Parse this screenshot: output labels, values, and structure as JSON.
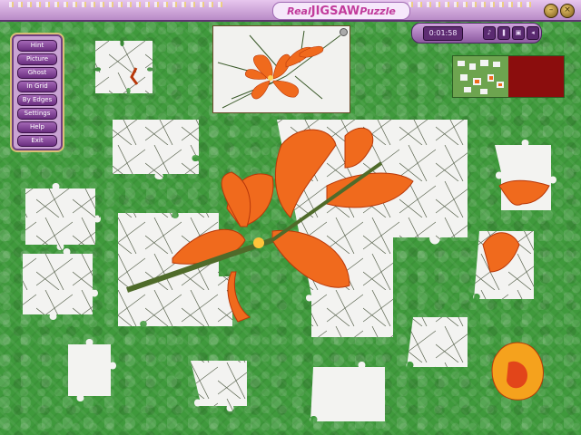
{
  "title": {
    "part1": "Real",
    "part2": "JIGSAW",
    "part3": "Puzzle"
  },
  "menu": {
    "items": [
      {
        "label": "Hint"
      },
      {
        "label": "Picture"
      },
      {
        "label": "Ghost"
      },
      {
        "label": "In Grid"
      },
      {
        "label": "By Edges"
      },
      {
        "label": "Settings"
      },
      {
        "label": "Help"
      },
      {
        "label": "Exit"
      }
    ]
  },
  "timer": {
    "value": "0:01:58"
  },
  "colors": {
    "board_green": "#3f9a3c",
    "menu_purple": "#6a2e80",
    "minimap_red": "#8b0d0d",
    "petal_orange": "#f06a1d"
  },
  "icons": [
    "minimize-icon",
    "close-icon",
    "timer-control-icons",
    "preview-close-icon"
  ]
}
